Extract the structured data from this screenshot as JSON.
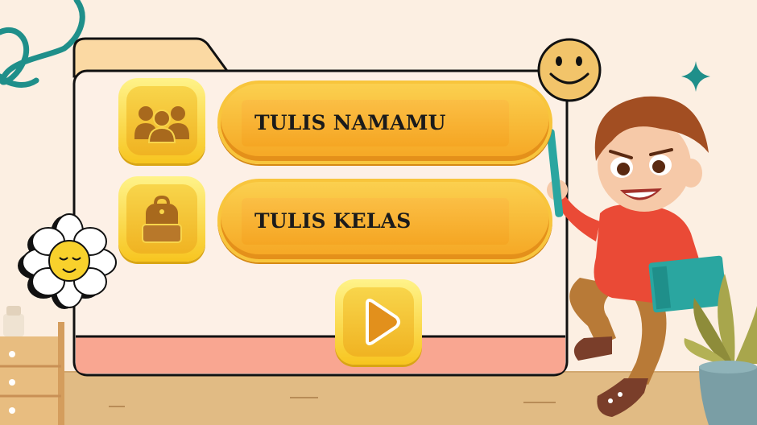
{
  "form": {
    "name_label": "TULIS NAMAMU",
    "class_label": "TULIS KELAS"
  },
  "icons": {
    "name_icon": "people-group-icon",
    "class_icon": "backpack-icon",
    "play_icon": "play-icon"
  },
  "colors": {
    "background": "#fcefe2",
    "panel": "#fdf0e6",
    "panel_bottom": "#f9a691",
    "button_orange": "#f5a623",
    "button_yellow": "#f8d54b",
    "floor": "#e1bb84"
  }
}
